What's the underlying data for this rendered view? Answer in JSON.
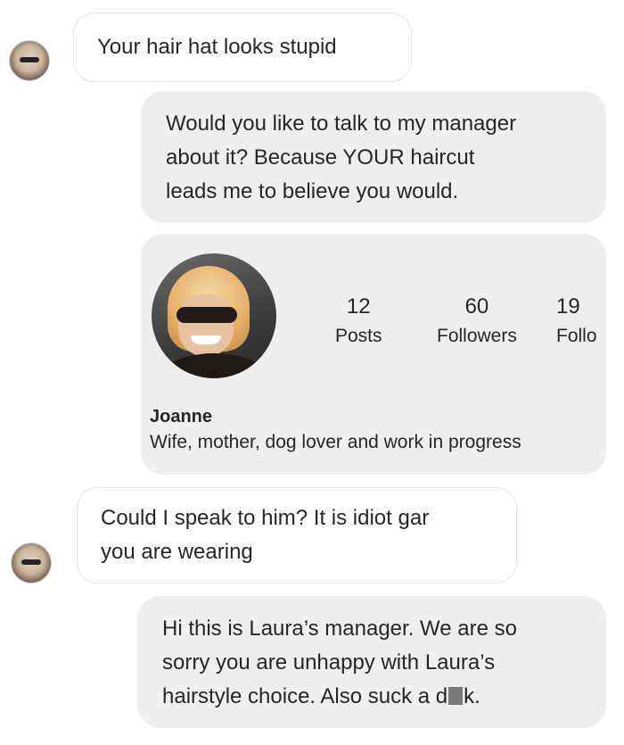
{
  "conversation": {
    "messages": [
      {
        "direction": "incoming",
        "text": "Your hair hat looks stupid"
      },
      {
        "direction": "outgoing",
        "lines": [
          "Would you like to talk to my manager",
          "about it?  Because YOUR haircut",
          "leads me to believe you would."
        ]
      },
      {
        "direction": "incoming",
        "lines": [
          "Could I speak to him?  It is idiot gar",
          "you are wearing"
        ]
      },
      {
        "direction": "outgoing",
        "lines": [
          "Hi this is Laura’s manager.  We are so",
          "sorry you are unhappy with Laura’s",
          "hairstyle choice. Also suck a d"
        ],
        "tail": "k."
      }
    ],
    "shared_profile": {
      "name": "Joanne",
      "bio": "Wife, mother, dog lover and work in progress",
      "stats": [
        {
          "value": "12",
          "label": "Posts"
        },
        {
          "value": "60",
          "label": "Followers"
        },
        {
          "value": "19",
          "label": "Follo"
        }
      ]
    },
    "colors": {
      "incoming_bubble_bg": "#ffffff",
      "incoming_bubble_border": "#e3e3e3",
      "outgoing_bubble_bg": "#efefef",
      "text": "#262626"
    }
  }
}
